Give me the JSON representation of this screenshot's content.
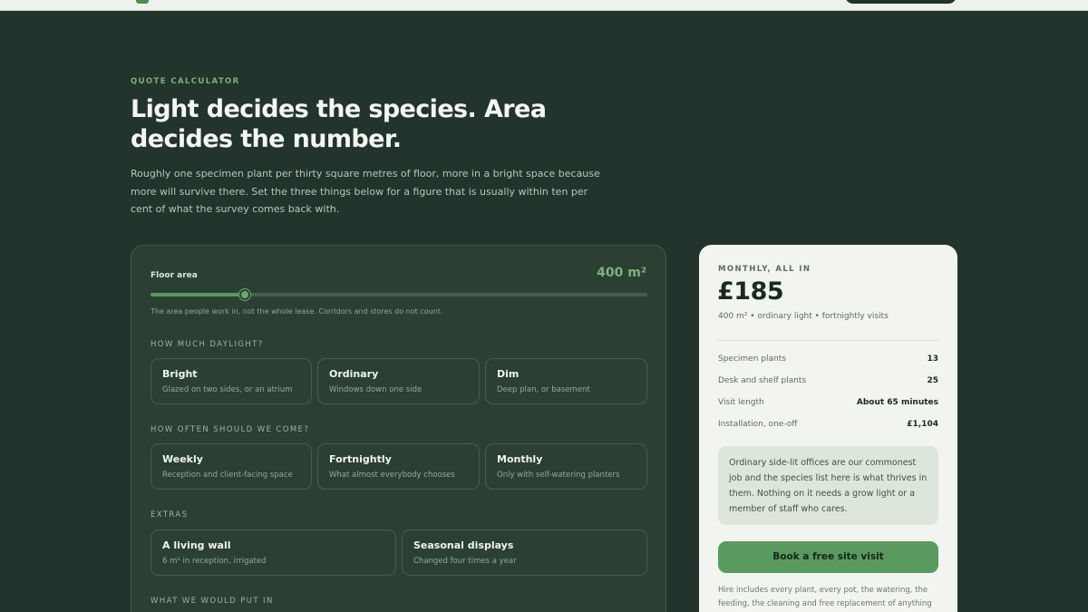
{
  "eyebrow": "QUOTE CALCULATOR",
  "headline": "Light decides the species. Area decides the number.",
  "intro": "Roughly one specimen plant per thirty square metres of floor, more in a bright space because more will survive there. Set the three things below for a figure that is usually within ten per cent of what the survey comes back with.",
  "calculator": {
    "floor_area": {
      "label": "Floor area",
      "value": "400 m²",
      "slider_fraction": 0.19,
      "hint": "The area people work in, not the whole lease. Corridors and stores do not count."
    },
    "daylight": {
      "label": "HOW MUCH DAYLIGHT?",
      "options": [
        {
          "title": "Bright",
          "sub": "Glazed on two sides, or an atrium",
          "selected": false
        },
        {
          "title": "Ordinary",
          "sub": "Windows down one side",
          "selected": true
        },
        {
          "title": "Dim",
          "sub": "Deep plan, or basement",
          "selected": false
        }
      ]
    },
    "frequency": {
      "label": "HOW OFTEN SHOULD WE COME?",
      "options": [
        {
          "title": "Weekly",
          "sub": "Reception and client-facing space",
          "selected": false
        },
        {
          "title": "Fortnightly",
          "sub": "What almost everybody chooses",
          "selected": true
        },
        {
          "title": "Monthly",
          "sub": "Only with self-watering planters",
          "selected": false
        }
      ]
    },
    "extras": {
      "label": "EXTRAS",
      "options": [
        {
          "title": "A living wall",
          "sub": "6 m² in reception, irrigated",
          "selected": false
        },
        {
          "title": "Seasonal displays",
          "sub": "Changed four times a year",
          "selected": true
        }
      ]
    },
    "what_we_put_in": {
      "label": "WHAT WE WOULD PUT IN"
    }
  },
  "summary": {
    "eyebrow": "MONTHLY, ALL IN",
    "price": "£185",
    "meta": "400 m² • ordinary light • fortnightly visits",
    "rows": [
      {
        "label": "Specimen plants",
        "value": "13"
      },
      {
        "label": "Desk and shelf plants",
        "value": "25"
      },
      {
        "label": "Visit length",
        "value": "About 65 minutes"
      },
      {
        "label": "Installation, one-off",
        "value": "£1,104"
      }
    ],
    "note": "Ordinary side-lit offices are our commonest job and the species list here is what thrives in them. Nothing on it needs a grow light or a member of staff who cares.",
    "cta": "Book a free site visit",
    "fine_print": "Hire includes every plant, every pot, the watering, the feeding, the cleaning and free replacement of anything"
  },
  "colors": {
    "background": "#22342b",
    "panel": "#2b4033",
    "accent": "#7fb07e",
    "cta": "#5b9a5f",
    "summary_bg": "#f1f4ef"
  }
}
